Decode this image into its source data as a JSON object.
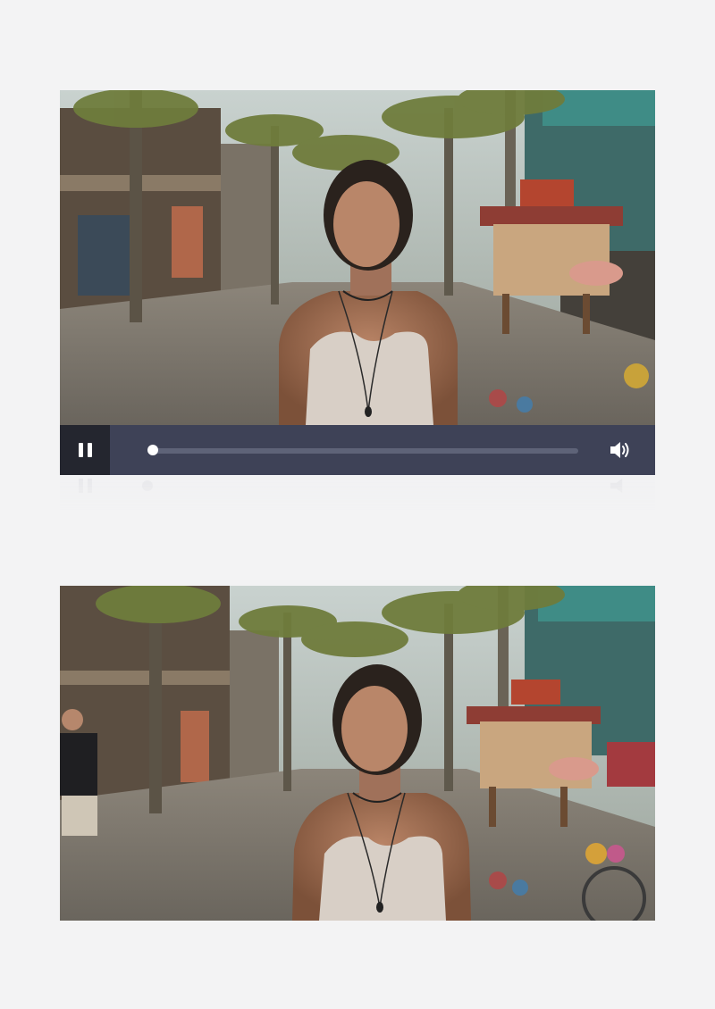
{
  "player": {
    "state": "playing",
    "play_toggle_icon": "pause-icon",
    "progress": 0.0,
    "volume_icon": "volume-icon",
    "colors": {
      "control_bar": "#3e4257",
      "play_button_bg": "#24262f",
      "track": "#5e6378",
      "thumb": "#ffffff"
    }
  },
  "frames": [
    {
      "name": "video-preview-frame",
      "scene": "woman-in-tank-top-on-palm-lined-market-street"
    },
    {
      "name": "still-image-frame",
      "scene": "woman-in-tank-top-on-palm-lined-market-street"
    }
  ]
}
